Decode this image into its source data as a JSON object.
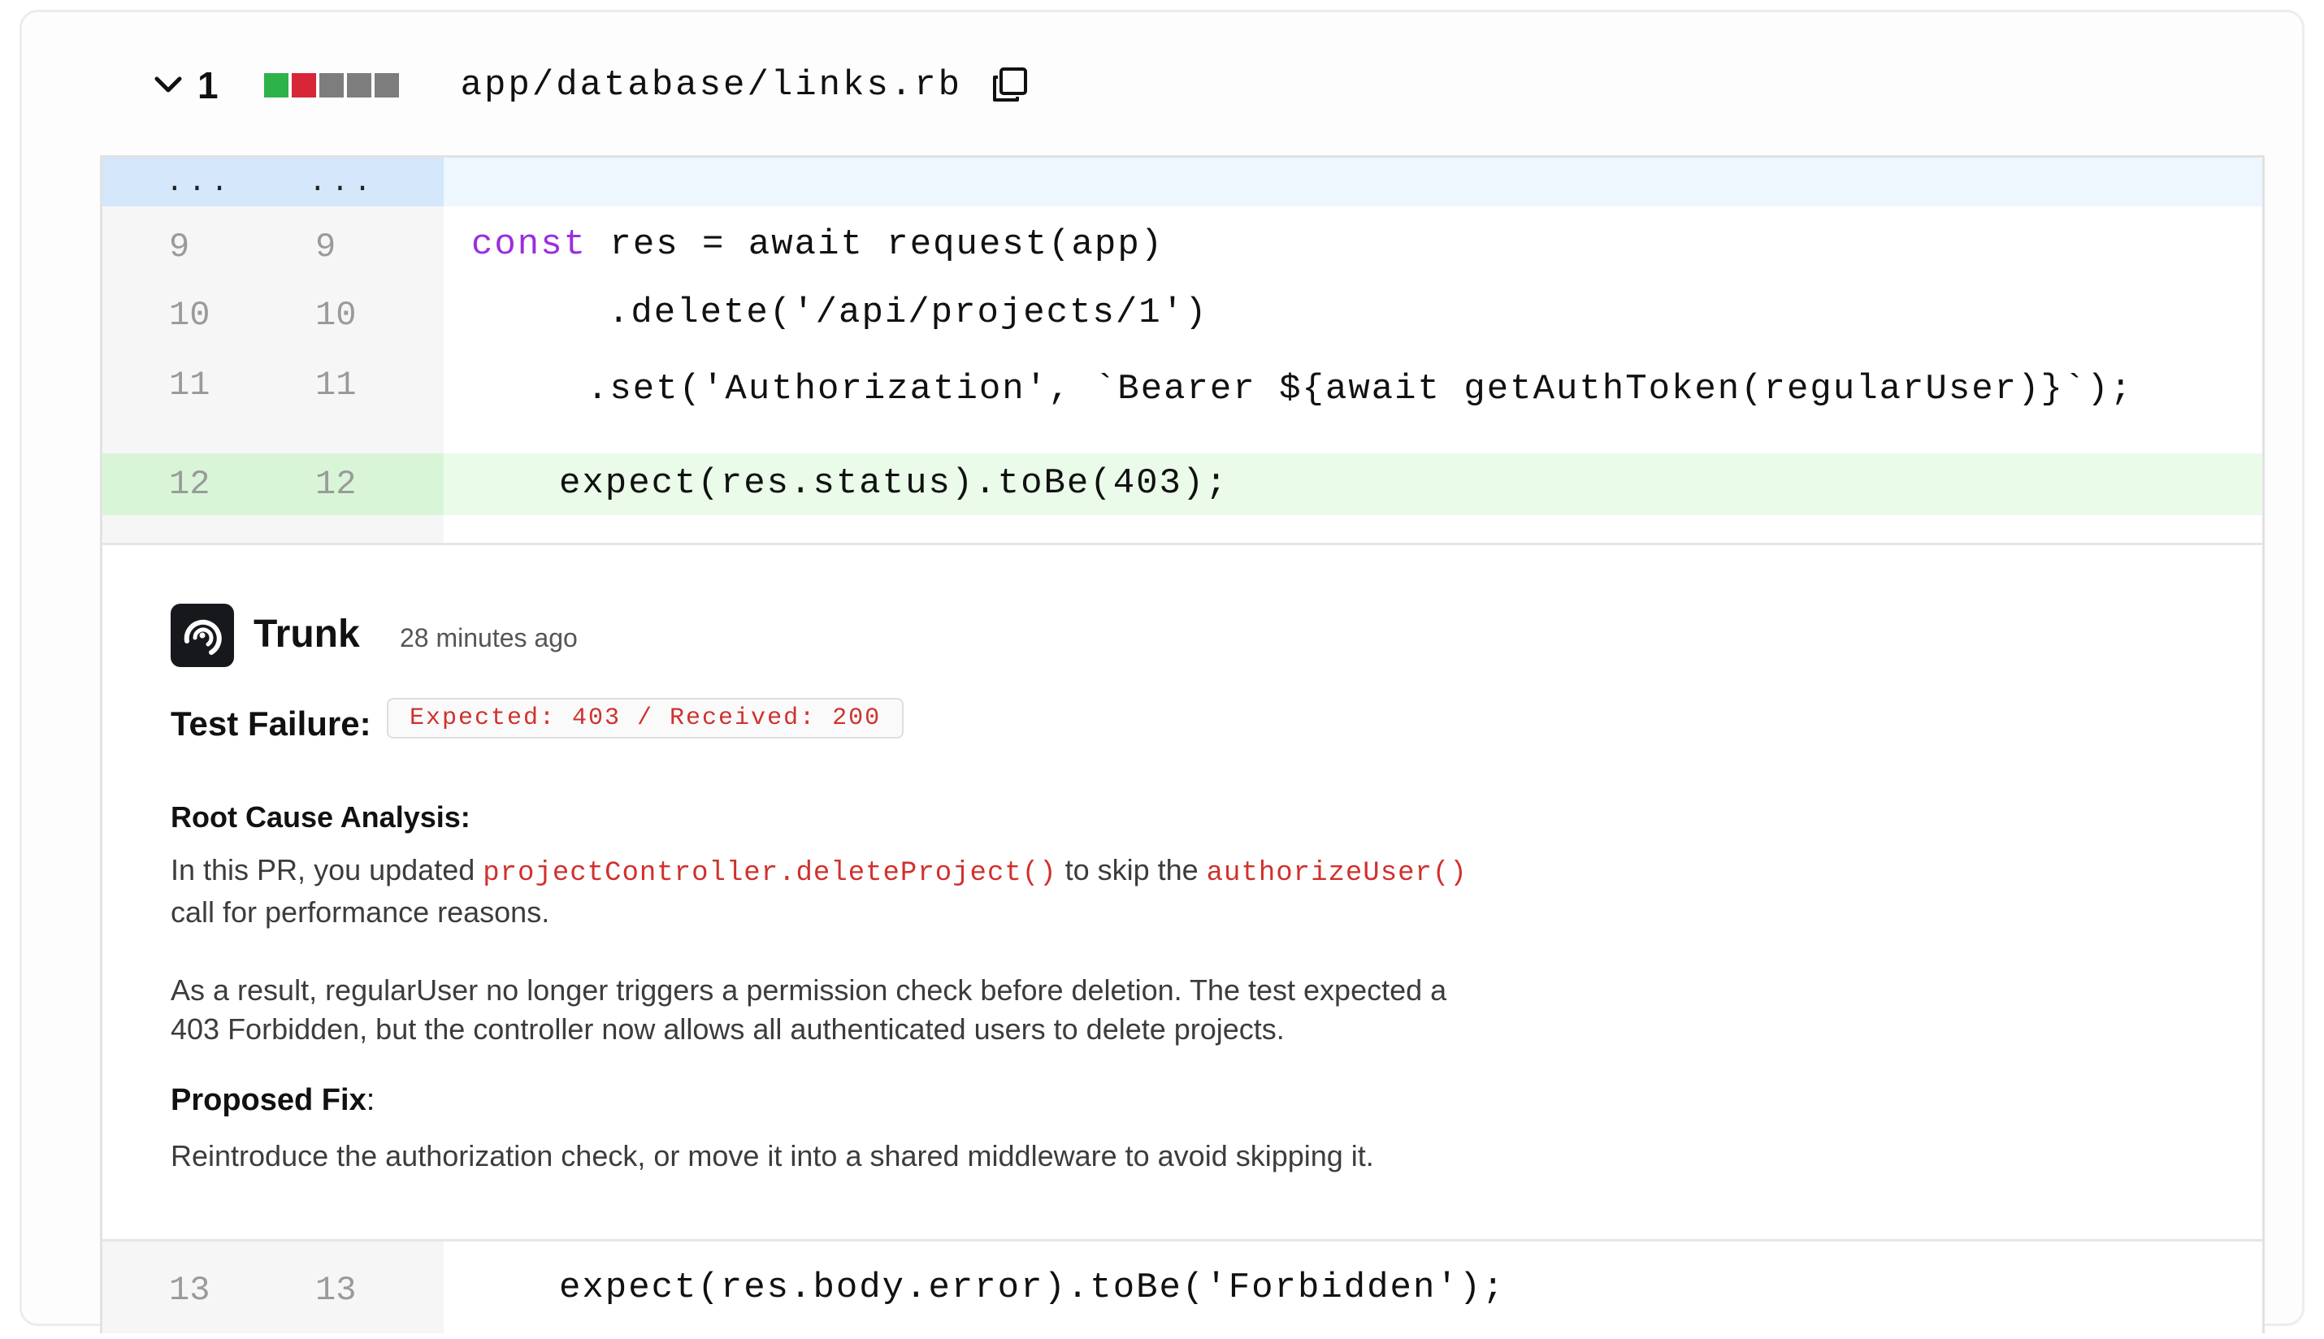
{
  "file": {
    "diff_index": "1",
    "path": "app/database/links.rb",
    "change_squares": [
      "#2eb24a",
      "#d72638",
      "#7d7d7d",
      "#7d7d7d",
      "#7d7d7d"
    ]
  },
  "hunk": {
    "old": "...",
    "new": "..."
  },
  "lines": [
    {
      "old": "9",
      "new": "9",
      "keyword": "const",
      "code": " res = await request(app)",
      "type": "context"
    },
    {
      "old": "10",
      "new": "10",
      "keyword": "",
      "code": ".delete('/api/projects/1')",
      "type": "context"
    },
    {
      "old": "11",
      "new": "11",
      "keyword": "",
      "code": ".set('Authorization', `Bearer ${await getAuthToken(regularUser)}`);",
      "type": "context"
    },
    {
      "old": "12",
      "new": "12",
      "keyword": "",
      "code": "expect(res.status).toBe(403);",
      "type": "added"
    },
    {
      "old": "13",
      "new": "13",
      "keyword": "",
      "code": "expect(res.body.error).toBe('Forbidden');",
      "type": "context"
    }
  ],
  "comment": {
    "author": "Trunk",
    "time": "28 minutes ago",
    "test_failure_label": "Test Failure:",
    "test_failure_value": "Expected: 403 / Received: 200",
    "rca_heading": "Root Cause Analysis:",
    "rca_p1_a": "In this PR, you updated",
    "rca_p1_code1": "projectController.deleteProject()",
    "rca_p1_b": "to skip the",
    "rca_p1_code2": "authorizeUser()",
    "rca_p1_c": "call for performance reasons.",
    "rca_p2_l1": "As a result, regularUser no longer triggers a permission check before deletion. The test expected a",
    "rca_p2_l2": "403 Forbidden, but the controller now allows all authenticated users to delete projects.",
    "fix_heading": "Proposed Fix",
    "fix_colon": ":",
    "fix_text": "Reintroduce the authorization check, or move it into a shared middleware to avoid skipping it."
  },
  "colors": {
    "keyword": "#9a2ee0",
    "error_code": "#d0312d",
    "added_bg": "#eafbea",
    "hunk_bg": "#eef6ff"
  }
}
